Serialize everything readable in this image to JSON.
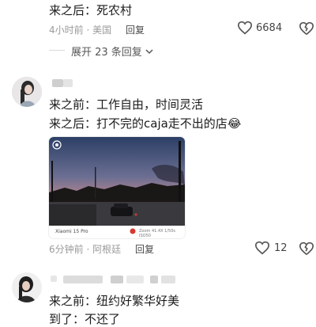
{
  "comment_top": {
    "text_after": "来之后：死农村",
    "time": "4小时前",
    "location": "美国",
    "reply_label": "回复",
    "like_count": "6684",
    "expand_label": "展开 23 条回复"
  },
  "comment_main": {
    "line_before": "来之前：工作自由，时间灵活",
    "line_after": "来之后：打不完的caja走不出的店",
    "emoji": "😂",
    "photo": {
      "camera_watermark": "Xiaomi 15 Pro",
      "photo_meta": "Zoom 41.4X 1/50s ISO50"
    },
    "time": "6分钟前",
    "location": "阿根廷",
    "reply_label": "回复",
    "like_count": "12"
  },
  "comment_bottom": {
    "line_before": "来之前：纽约好繁华好美",
    "line_after_partial": "到了：不还了"
  },
  "colors": {
    "heart": "#555555",
    "accent_red": "#d63a2f",
    "sunset": "#e7724f"
  }
}
